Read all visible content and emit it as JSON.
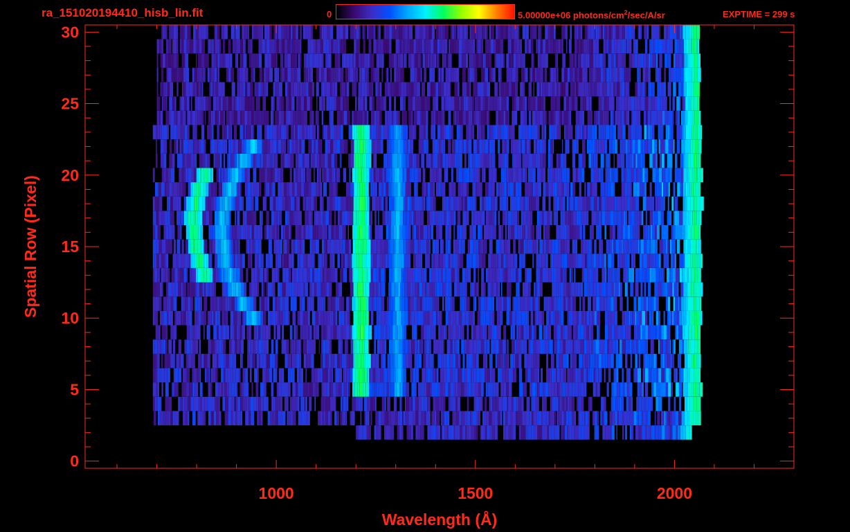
{
  "header": {
    "filename": "ra_151020194410_hisb_lin.fit",
    "colorbar_min": "0",
    "colorbar_max_label_pre": "5.00000e+06 photons/cm",
    "colorbar_max_label_sup": "2",
    "colorbar_max_label_post": "/sec/A/sr",
    "exptime": "EXPTIME = 299 s"
  },
  "colors": {
    "axis": "#ff2a1a",
    "background": "#000000",
    "colormap": [
      "#000000",
      "#3a0a6e",
      "#3d2cc8",
      "#0050ff",
      "#00a8ff",
      "#00f0ff",
      "#00ff60",
      "#90ff00",
      "#ffff00",
      "#ff8000",
      "#ff1000"
    ]
  },
  "chart_data": {
    "type": "heatmap",
    "title": "ra_151020194410_hisb_lin.fit",
    "xlabel": "Wavelength (Å)",
    "ylabel": "Spatial Row (Pixel)",
    "xlim": [
      520,
      2300
    ],
    "ylim": [
      -0.5,
      30.5
    ],
    "xticks": [
      1000,
      1500,
      2000
    ],
    "yticks": [
      0,
      5,
      10,
      15,
      20,
      25,
      30
    ],
    "colorbar_range": [
      0,
      5000000
    ],
    "colorbar_units": "photons/cm²/sec/A/sr",
    "exptime_s": 299,
    "features": [
      {
        "name": "arc-outer",
        "x_center": 790,
        "rows": [
          13,
          20
        ],
        "level": 0.6
      },
      {
        "name": "arc-inner",
        "x_center": 860,
        "rows": [
          10,
          22
        ],
        "level": 0.45
      },
      {
        "name": "line-1216",
        "x_center": 1210,
        "rows": [
          5,
          23
        ],
        "level": 0.62
      },
      {
        "name": "line-1304",
        "x_center": 1302,
        "rows": [
          5,
          23
        ],
        "level": 0.42
      },
      {
        "name": "red-edge-band",
        "x_center": 2050,
        "rows": [
          2,
          30
        ],
        "level": 0.58
      }
    ]
  }
}
